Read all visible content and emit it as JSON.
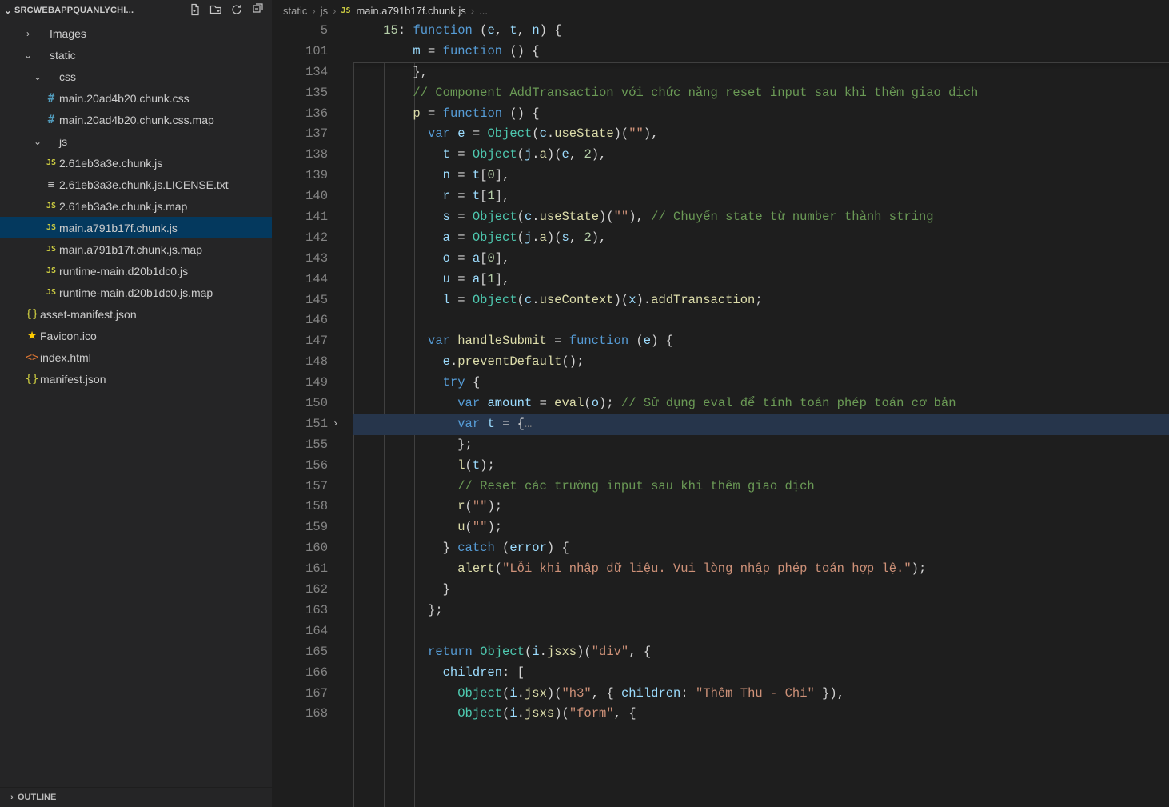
{
  "explorer": {
    "title": "SRCWEBAPPQUANLYCHI...",
    "actions": {
      "newFile": "new-file",
      "newFolder": "new-folder",
      "refresh": "refresh",
      "collapse": "collapse-all"
    }
  },
  "tree": [
    {
      "indent": 28,
      "chev": "›",
      "icon": "",
      "iconCls": "",
      "label": "Images"
    },
    {
      "indent": 28,
      "chev": "⌄",
      "icon": "",
      "iconCls": "",
      "label": "static"
    },
    {
      "indent": 40,
      "chev": "⌄",
      "icon": "",
      "iconCls": "",
      "label": "css"
    },
    {
      "indent": 40,
      "chev": "",
      "icon": "#",
      "iconCls": "ico-hash",
      "label": "main.20ad4b20.chunk.css"
    },
    {
      "indent": 40,
      "chev": "",
      "icon": "#",
      "iconCls": "ico-hash",
      "label": "main.20ad4b20.chunk.css.map"
    },
    {
      "indent": 40,
      "chev": "⌄",
      "icon": "",
      "iconCls": "",
      "label": "js"
    },
    {
      "indent": 40,
      "chev": "",
      "icon": "JS",
      "iconCls": "ico-js",
      "label": "2.61eb3a3e.chunk.js"
    },
    {
      "indent": 40,
      "chev": "",
      "icon": "≡",
      "iconCls": "ico-txt",
      "label": "2.61eb3a3e.chunk.js.LICENSE.txt"
    },
    {
      "indent": 40,
      "chev": "",
      "icon": "JS",
      "iconCls": "ico-js",
      "label": "2.61eb3a3e.chunk.js.map"
    },
    {
      "indent": 40,
      "chev": "",
      "icon": "JS",
      "iconCls": "ico-js",
      "label": "main.a791b17f.chunk.js",
      "active": true
    },
    {
      "indent": 40,
      "chev": "",
      "icon": "JS",
      "iconCls": "ico-js",
      "label": "main.a791b17f.chunk.js.map"
    },
    {
      "indent": 40,
      "chev": "",
      "icon": "JS",
      "iconCls": "ico-js",
      "label": "runtime-main.d20b1dc0.js"
    },
    {
      "indent": 40,
      "chev": "",
      "icon": "JS",
      "iconCls": "ico-js",
      "label": "runtime-main.d20b1dc0.js.map"
    },
    {
      "indent": 16,
      "chev": "",
      "icon": "{}",
      "iconCls": "ico-json",
      "label": "asset-manifest.json"
    },
    {
      "indent": 16,
      "chev": "",
      "icon": "★",
      "iconCls": "ico-star",
      "label": "Favicon.ico"
    },
    {
      "indent": 16,
      "chev": "",
      "icon": "<>",
      "iconCls": "ico-html",
      "label": "index.html"
    },
    {
      "indent": 16,
      "chev": "",
      "icon": "{}",
      "iconCls": "ico-json",
      "label": "manifest.json"
    }
  ],
  "outline": {
    "label": "OUTLINE"
  },
  "breadcrumb": {
    "p0": "static",
    "p1": "js",
    "p2": "main.a791b17f.chunk.js",
    "p3": "..."
  },
  "lineNumbers": [
    "5",
    "101",
    "134",
    "135",
    "136",
    "137",
    "138",
    "139",
    "140",
    "141",
    "142",
    "143",
    "144",
    "145",
    "146",
    "147",
    "148",
    "149",
    "150",
    "151",
    "155",
    "156",
    "157",
    "158",
    "159",
    "160",
    "161",
    "162",
    "163",
    "164",
    "165",
    "166",
    "167",
    "168"
  ],
  "code": {
    "l5": {
      "a": "15",
      "b": ": ",
      "c": "function",
      "d": " (",
      "e": "e",
      "f": ", ",
      "g": "t",
      "h": ", ",
      "i": "n",
      "j": ") {"
    },
    "l101": {
      "a": "m",
      "b": " = ",
      "c": "function",
      "d": " () {"
    },
    "l134": {
      "a": "},"
    },
    "l135": {
      "a": "// Component AddTransaction với chức năng reset input sau khi thêm giao dịch"
    },
    "l136": {
      "a": "p",
      "b": " = ",
      "c": "function",
      "d": " () {"
    },
    "l137": {
      "a": "var",
      "b": " ",
      "c": "e",
      "d": " = ",
      "e": "Object",
      "f": "(",
      "g": "c",
      "h": ".",
      "i": "useState",
      "j": ")(",
      "k": "\"\"",
      "l": "),"
    },
    "l138": {
      "a": "t",
      "b": " = ",
      "c": "Object",
      "d": "(",
      "e": "j",
      "f": ".",
      "g": "a",
      "h": ")(",
      "i": "e",
      "j": ", ",
      "k": "2",
      "l": "),"
    },
    "l139": {
      "a": "n",
      "b": " = ",
      "c": "t",
      "d": "[",
      "e": "0",
      "f": "],"
    },
    "l140": {
      "a": "r",
      "b": " = ",
      "c": "t",
      "d": "[",
      "e": "1",
      "f": "],"
    },
    "l141": {
      "a": "s",
      "b": " = ",
      "c": "Object",
      "d": "(",
      "e": "c",
      "f": ".",
      "g": "useState",
      "h": ")(",
      "i": "\"\"",
      "j": "), ",
      "k": "// Chuyển state từ number thành string"
    },
    "l142": {
      "a": "a",
      "b": " = ",
      "c": "Object",
      "d": "(",
      "e": "j",
      "f": ".",
      "g": "a",
      "h": ")(",
      "i": "s",
      "j": ", ",
      "k": "2",
      "l": "),"
    },
    "l143": {
      "a": "o",
      "b": " = ",
      "c": "a",
      "d": "[",
      "e": "0",
      "f": "],"
    },
    "l144": {
      "a": "u",
      "b": " = ",
      "c": "a",
      "d": "[",
      "e": "1",
      "f": "],"
    },
    "l145": {
      "a": "l",
      "b": " = ",
      "c": "Object",
      "d": "(",
      "e": "c",
      "f": ".",
      "g": "useContext",
      "h": ")(",
      "i": "x",
      "j": ").",
      "k": "addTransaction",
      "l": ";"
    },
    "l146": {
      "a": ""
    },
    "l147": {
      "a": "var",
      "b": " ",
      "c": "handleSubmit",
      "d": " = ",
      "e": "function",
      "f": " (",
      "g": "e",
      "h": ") {"
    },
    "l148": {
      "a": "e",
      "b": ".",
      "c": "preventDefault",
      "d": "();"
    },
    "l149": {
      "a": "try",
      "b": " {"
    },
    "l150": {
      "a": "var",
      "b": " ",
      "c": "amount",
      "d": " = ",
      "e": "eval",
      "f": "(",
      "g": "o",
      "h": "); ",
      "i": "// Sử dụng eval để tính toán phép toán cơ bản"
    },
    "l151": {
      "a": "var",
      "b": " ",
      "c": "t",
      "d": " = {",
      "e": "…"
    },
    "l155": {
      "a": "};"
    },
    "l156": {
      "a": "l",
      "b": "(",
      "c": "t",
      "d": ");"
    },
    "l157": {
      "a": "// Reset các trường input sau khi thêm giao dịch"
    },
    "l158": {
      "a": "r",
      "b": "(",
      "c": "\"\"",
      "d": ");"
    },
    "l159": {
      "a": "u",
      "b": "(",
      "c": "\"\"",
      "d": ");"
    },
    "l160": {
      "a": "} ",
      "b": "catch",
      "c": " (",
      "d": "error",
      "e": ") {"
    },
    "l161": {
      "a": "alert",
      "b": "(",
      "c": "\"Lỗi khi nhập dữ liệu. Vui lòng nhập phép toán hợp lệ.\"",
      "d": ");"
    },
    "l162": {
      "a": "}"
    },
    "l163": {
      "a": "};"
    },
    "l164": {
      "a": ""
    },
    "l165": {
      "a": "return",
      "b": " ",
      "c": "Object",
      "d": "(",
      "e": "i",
      "f": ".",
      "g": "jsxs",
      "h": ")(",
      "i": "\"div\"",
      "j": ", {"
    },
    "l166": {
      "a": "children",
      "b": ": ["
    },
    "l167": {
      "a": "Object",
      "b": "(",
      "c": "i",
      "d": ".",
      "e": "jsx",
      "f": ")(",
      "g": "\"h3\"",
      "h": ", { ",
      "i": "children",
      "j": ": ",
      "k": "\"Thêm Thu - Chi\"",
      "l": " }),"
    },
    "l168": {
      "a": "Object",
      "b": "(",
      "c": "i",
      "d": ".",
      "e": "jsxs",
      "f": ")(",
      "g": "\"form\"",
      "h": ", {"
    }
  }
}
